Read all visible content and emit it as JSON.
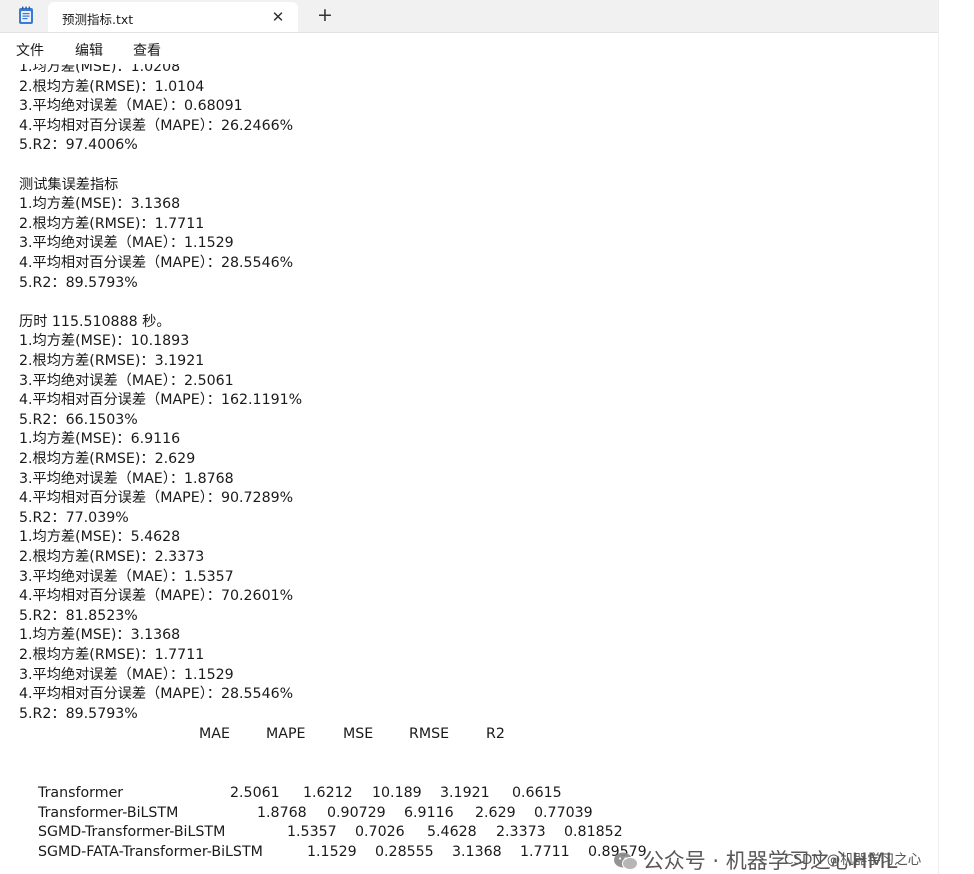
{
  "tab": {
    "title": "预测指标.txt",
    "close_glyph": "✕",
    "new_tab_glyph": "+"
  },
  "menu": {
    "items": [
      "文件",
      "编辑",
      "查看"
    ]
  },
  "editor": {
    "lines": [
      "1.均方差(MSE)：1.0208",
      "2.根均方差(RMSE)：1.0104",
      "3.平均绝对误差（MAE）：0.68091",
      "4.平均相对百分误差（MAPE）：26.2466%",
      "5.R2：97.4006%",
      "",
      "测试集误差指标",
      "1.均方差(MSE)：3.1368",
      "2.根均方差(RMSE)：1.7711",
      "3.平均绝对误差（MAE）：1.1529",
      "4.平均相对百分误差（MAPE）：28.5546%",
      "5.R2：89.5793%",
      "",
      "历时 115.510888 秒。",
      "1.均方差(MSE)：10.1893",
      "2.根均方差(RMSE)：3.1921",
      "3.平均绝对误差（MAE）：2.5061",
      "4.平均相对百分误差（MAPE）：162.1191%",
      "5.R2：66.1503%",
      "1.均方差(MSE)：6.9116",
      "2.根均方差(RMSE)：2.629",
      "3.平均绝对误差（MAE）：1.8768",
      "4.平均相对百分误差（MAPE）：90.7289%",
      "5.R2：77.039%",
      "1.均方差(MSE)：5.4628",
      "2.根均方差(RMSE)：2.3373",
      "3.平均绝对误差（MAE）：1.5357",
      "4.平均相对百分误差（MAPE）：70.2601%",
      "5.R2：81.8523%",
      "1.均方差(MSE)：3.1368",
      "2.根均方差(RMSE)：1.7711",
      "3.平均绝对误差（MAE）：1.1529",
      "4.平均相对百分误差（MAPE）：28.5546%",
      "5.R2：89.5793%"
    ],
    "table": {
      "headers": [
        "MAE",
        "MAPE",
        "MSE",
        "RMSE",
        "R2"
      ],
      "rows": [
        {
          "model": "Transformer",
          "values": [
            "2.5061",
            "1.6212",
            "10.189",
            "3.1921",
            "0.6615"
          ]
        },
        {
          "model": "Transformer-BiLSTM",
          "values": [
            "1.8768",
            "0.90729",
            "6.9116",
            "2.629",
            "0.77039"
          ]
        },
        {
          "model": "SGMD-Transformer-BiLSTM",
          "values": [
            "1.5357",
            "0.7026",
            "5.4628",
            "2.3373",
            "0.81852"
          ]
        },
        {
          "model": "SGMD-FATA-Transformer-BiLSTM",
          "values": [
            "1.1529",
            "0.28555",
            "3.1368",
            "1.7711",
            "0.89579"
          ]
        }
      ]
    }
  },
  "watermark": {
    "main": "公众号 · 机器学习之心HML",
    "csdn": "CSDN @机器学习之心"
  },
  "icons": {
    "app": "notepad-icon",
    "wechat": "wechat-icon"
  },
  "colors": {
    "tabbar_bg": "#f1f1f1",
    "text": "#1a1a1a",
    "watermark": "#4a4a4a",
    "notepad_icon": "#3b7bd4"
  }
}
